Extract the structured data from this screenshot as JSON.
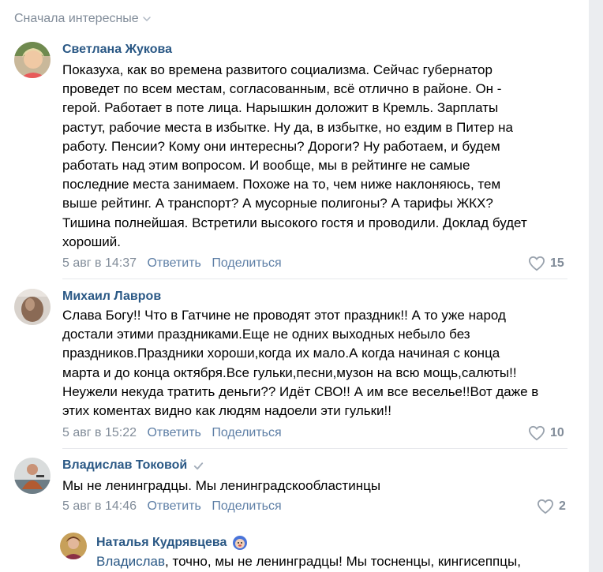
{
  "sort_label": "Сначала интересные",
  "comments": [
    {
      "author": "Светлана Жукова",
      "lines": [
        "Показуха, как во времена развитого социализма. Сейчас губернатор",
        "проведет по всем местам, согласованным, всё отлично в районе. Он -",
        "герой. Работает в поте лица. Нарышкин доложит в Кремль. Зарплаты",
        "растут, рабочие места в избытке. Ну да, в избытке, но ездим в Питер на",
        "работу. Пенсии? Кому они интересны? Дороги? Ну работаем, и будем",
        "работать над этим вопросом. И вообще, мы в рейтинге не самые",
        "последние места занимаем. Похоже на то, чем ниже наклоняюсь, тем",
        "выше рейтинг. А транспорт? А мусорные полигоны? А тарифы ЖКХ?",
        "Тишина полнейшая. Встретили высокого гостя и проводили. Доклад будет",
        "хороший."
      ],
      "date": "5 авг в 14:37",
      "reply": "Ответить",
      "share": "Поделиться",
      "likes": "15"
    },
    {
      "author": "Михаил Лавров",
      "lines": [
        "Слава Богу!! Что в Гатчине не проводят этот праздник!! А то уже народ",
        "достали этими праздниками.Еще не одних выходных небыло без",
        "праздников.Праздники хороши,когда их мало.А когда начиная с конца",
        "марта и до конца октября.Все гульки,песни,музон на всю мощь,салюты!!",
        "Неужели некуда тратить деньги?? Идёт СВО!! А им все веселье!!Вот даже в",
        "этих коментах видно как людям надоели эти гульки!!"
      ],
      "date": "5 авг в 15:22",
      "reply": "Ответить",
      "share": "Поделиться",
      "likes": "10"
    },
    {
      "author": "Владислав Токовой",
      "lines": [
        "Мы не ленинградцы. Мы ленинградскообластинцы"
      ],
      "date": "5 авг в 14:46",
      "reply": "Ответить",
      "share": "Поделиться",
      "likes": "2"
    }
  ],
  "reply_comment": {
    "author": "Наталья Кудрявцева",
    "mention": "Владислав",
    "text": ", точно, мы не ленинградцы! Мы тосненцы, кингисеппцы,"
  },
  "colors": {
    "link": "#2a5885",
    "muted": "#818c99",
    "action": "#5e7fa6",
    "background": "#ebedf0"
  }
}
